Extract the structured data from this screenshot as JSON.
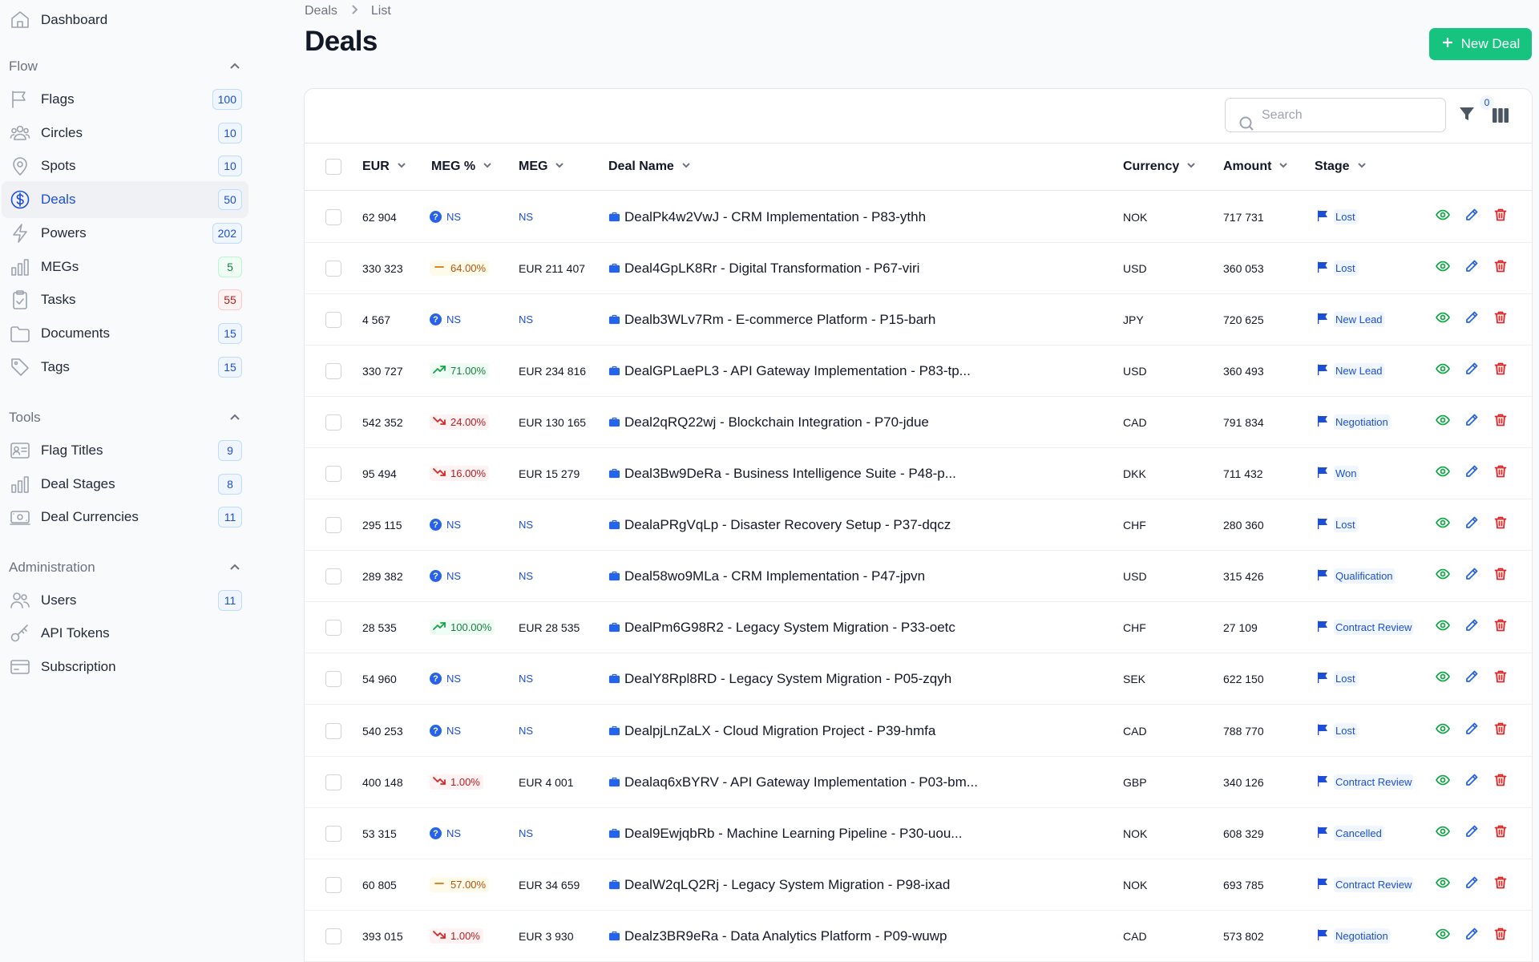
{
  "sidebar": {
    "dashboard": "Dashboard",
    "sections": [
      {
        "title": "Flow",
        "items": [
          {
            "label": "Flags",
            "count": "100",
            "icon": "flag-icon",
            "badge": "blue"
          },
          {
            "label": "Circles",
            "count": "10",
            "icon": "users-group-icon",
            "badge": "blue"
          },
          {
            "label": "Spots",
            "count": "10",
            "icon": "map-pin-icon",
            "badge": "blue"
          },
          {
            "label": "Deals",
            "count": "50",
            "icon": "dollar-circle-icon",
            "badge": "blue",
            "active": true
          },
          {
            "label": "Powers",
            "count": "202",
            "icon": "bolt-icon",
            "badge": "blue"
          },
          {
            "label": "MEGs",
            "count": "5",
            "icon": "bar-chart-icon",
            "badge": "green"
          },
          {
            "label": "Tasks",
            "count": "55",
            "icon": "clipboard-check-icon",
            "badge": "red"
          },
          {
            "label": "Documents",
            "count": "15",
            "icon": "folder-icon",
            "badge": "blue"
          },
          {
            "label": "Tags",
            "count": "15",
            "icon": "tag-icon",
            "badge": "blue"
          }
        ]
      },
      {
        "title": "Tools",
        "items": [
          {
            "label": "Flag Titles",
            "count": "9",
            "icon": "id-card-icon",
            "badge": "blue"
          },
          {
            "label": "Deal Stages",
            "count": "8",
            "icon": "bar-chart-icon",
            "badge": "blue"
          },
          {
            "label": "Deal Currencies",
            "count": "11",
            "icon": "banknote-icon",
            "badge": "blue"
          }
        ]
      },
      {
        "title": "Administration",
        "items": [
          {
            "label": "Users",
            "count": "11",
            "icon": "users-icon",
            "badge": "blue"
          },
          {
            "label": "API Tokens",
            "count": "",
            "icon": "key-icon",
            "badge": ""
          },
          {
            "label": "Subscription",
            "count": "",
            "icon": "credit-card-icon",
            "badge": ""
          }
        ]
      }
    ]
  },
  "header": {
    "breadcrumb": [
      "Deals",
      "List"
    ],
    "title": "Deals",
    "new_button": "New Deal"
  },
  "toolbar": {
    "search_placeholder": "Search",
    "filter_count": "0"
  },
  "table": {
    "columns": {
      "eur": "EUR",
      "meg_pct": "MEG %",
      "meg": "MEG",
      "deal_name": "Deal Name",
      "currency": "Currency",
      "amount": "Amount",
      "stage": "Stage"
    },
    "rows": [
      {
        "eur": "62 904",
        "meg_pct": "NS",
        "trend": "ns",
        "meg": "NS",
        "deal": "DealPk4w2VwJ - CRM Implementation - P83-ythh",
        "currency": "NOK",
        "amount": "717 731",
        "stage": "Lost"
      },
      {
        "eur": "330 323",
        "meg_pct": "64.00%",
        "trend": "flat",
        "meg": "EUR 211 407",
        "deal": "Deal4GpLK8Rr - Digital Transformation - P67-viri",
        "currency": "USD",
        "amount": "360 053",
        "stage": "Lost"
      },
      {
        "eur": "4 567",
        "meg_pct": "NS",
        "trend": "ns",
        "meg": "NS",
        "deal": "Dealb3WLv7Rm - E-commerce Platform - P15-barh",
        "currency": "JPY",
        "amount": "720 625",
        "stage": "New Lead"
      },
      {
        "eur": "330 727",
        "meg_pct": "71.00%",
        "trend": "up",
        "meg": "EUR 234 816",
        "deal": "DealGPLaePL3 - API Gateway Implementation - P83-tp...",
        "currency": "USD",
        "amount": "360 493",
        "stage": "New Lead"
      },
      {
        "eur": "542 352",
        "meg_pct": "24.00%",
        "trend": "down",
        "meg": "EUR 130 165",
        "deal": "Deal2qRQ22wj - Blockchain Integration - P70-jdue",
        "currency": "CAD",
        "amount": "791 834",
        "stage": "Negotiation"
      },
      {
        "eur": "95 494",
        "meg_pct": "16.00%",
        "trend": "down",
        "meg": "EUR 15 279",
        "deal": "Deal3Bw9DeRa - Business Intelligence Suite - P48-p...",
        "currency": "DKK",
        "amount": "711 432",
        "stage": "Won"
      },
      {
        "eur": "295 115",
        "meg_pct": "NS",
        "trend": "ns",
        "meg": "NS",
        "deal": "DealaPRgVqLp - Disaster Recovery Setup - P37-dqcz",
        "currency": "CHF",
        "amount": "280 360",
        "stage": "Lost"
      },
      {
        "eur": "289 382",
        "meg_pct": "NS",
        "trend": "ns",
        "meg": "NS",
        "deal": "Deal58wo9MLa - CRM Implementation - P47-jpvn",
        "currency": "USD",
        "amount": "315 426",
        "stage": "Qualification"
      },
      {
        "eur": "28 535",
        "meg_pct": "100.00%",
        "trend": "up",
        "meg": "EUR 28 535",
        "deal": "DealPm6G98R2 - Legacy System Migration - P33-oetc",
        "currency": "CHF",
        "amount": "27 109",
        "stage": "Contract Review"
      },
      {
        "eur": "54 960",
        "meg_pct": "NS",
        "trend": "ns",
        "meg": "NS",
        "deal": "DealY8Rpl8RD - Legacy System Migration - P05-zqyh",
        "currency": "SEK",
        "amount": "622 150",
        "stage": "Lost"
      },
      {
        "eur": "540 253",
        "meg_pct": "NS",
        "trend": "ns",
        "meg": "NS",
        "deal": "DealpjLnZaLX - Cloud Migration Project - P39-hmfa",
        "currency": "CAD",
        "amount": "788 770",
        "stage": "Lost"
      },
      {
        "eur": "400 148",
        "meg_pct": "1.00%",
        "trend": "down",
        "meg": "EUR 4 001",
        "deal": "Dealaq6xBYRV - API Gateway Implementation - P03-bm...",
        "currency": "GBP",
        "amount": "340 126",
        "stage": "Contract Review"
      },
      {
        "eur": "53 315",
        "meg_pct": "NS",
        "trend": "ns",
        "meg": "NS",
        "deal": "Deal9EwjqbRb - Machine Learning Pipeline - P30-uou...",
        "currency": "NOK",
        "amount": "608 329",
        "stage": "Cancelled"
      },
      {
        "eur": "60 805",
        "meg_pct": "57.00%",
        "trend": "flat",
        "meg": "EUR 34 659",
        "deal": "DealW2qLQ2Rj - Legacy System Migration - P98-ixad",
        "currency": "NOK",
        "amount": "693 785",
        "stage": "Contract Review"
      },
      {
        "eur": "393 015",
        "meg_pct": "1.00%",
        "trend": "down",
        "meg": "EUR 3 930",
        "deal": "Dealz3BR9eRa - Data Analytics Platform - P09-wuwp",
        "currency": "CAD",
        "amount": "573 802",
        "stage": "Negotiation"
      }
    ]
  },
  "colors": {
    "accent": "#1d4ed8",
    "new_button": "#16c47f",
    "up": "#16a34a",
    "down": "#dc2626",
    "flat": "#d97706"
  }
}
